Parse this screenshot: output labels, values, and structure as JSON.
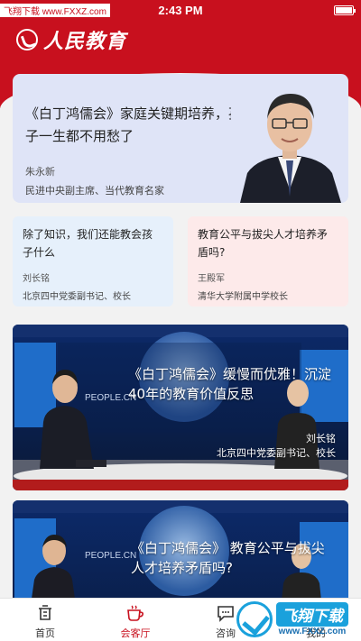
{
  "status_bar": {
    "watermark": "飞翔下载 www.FXXZ.com",
    "time": "2:43 PM"
  },
  "brand": {
    "logo_text": "人民教育"
  },
  "featured": {
    "title": "《白丁鸿儒会》家庭关键期培养，孩子一生都不用愁了",
    "name": "朱永新",
    "role": "民进中央副主席、当代教育名家"
  },
  "cards": [
    {
      "title": "除了知识，我们还能教会孩子什么",
      "name": "刘长铭",
      "role": "北京四中党委副书记、校长"
    },
    {
      "title": "教育公平与拔尖人才培养矛盾吗?",
      "name": "王殿军",
      "role": "清华大学附属中学校长"
    }
  ],
  "videos": [
    {
      "title": "《白丁鸿儒会》缓慢而优雅！沉淀40年的教育价值反思",
      "name": "刘长铭",
      "role": "北京四中党委副书记、校长",
      "screen_text": "PEOPLE.CN"
    },
    {
      "title": "《白丁鸿儒会》 教育公平与拔尖人才培养矛盾吗?",
      "screen_text": "PEOPLE.CN"
    }
  ],
  "tabbar": {
    "items": [
      {
        "label": "首页",
        "icon": "home-icon"
      },
      {
        "label": "会客厅",
        "icon": "cup-icon",
        "active": true
      },
      {
        "label": "咨询",
        "icon": "chat-icon"
      },
      {
        "label": "我的",
        "icon": "user-icon"
      }
    ]
  },
  "watermark_badge": {
    "main": "飞翔下载",
    "sub": "www.FXXZ.com"
  },
  "colors": {
    "accent": "#c8101e",
    "featured_bg": "#dfe4f7",
    "card_blue": "#e6f0fb",
    "card_pink": "#fdeaea"
  }
}
